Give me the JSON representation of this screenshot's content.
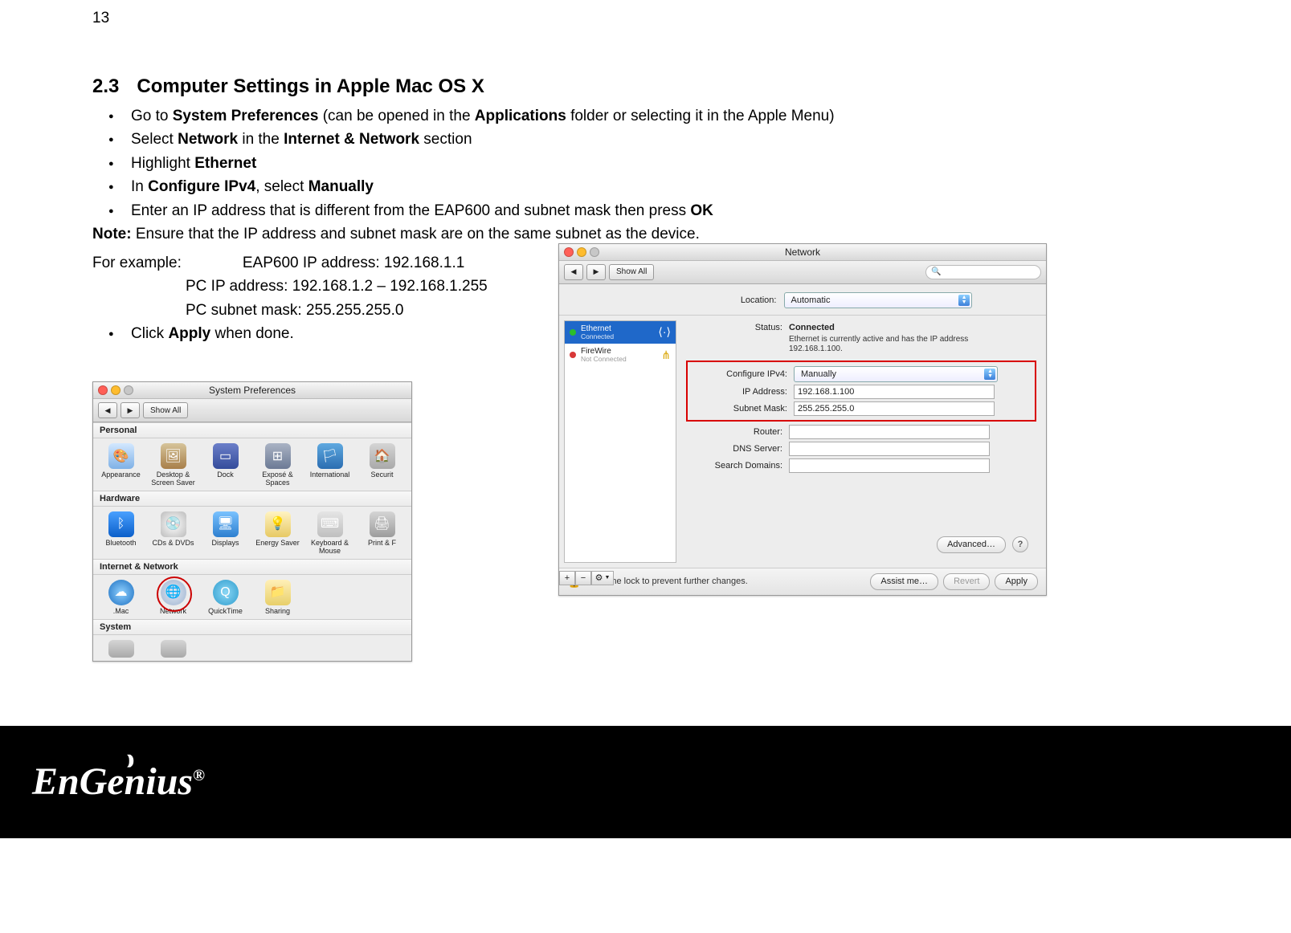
{
  "page_number": "13",
  "heading": {
    "num": "2.3",
    "title": "Computer Settings in Apple Mac OS X"
  },
  "bullets": [
    {
      "pre": "Go to ",
      "b1": "System Preferences",
      "mid": " (can be opened in the ",
      "b2": "Applications",
      "post": " folder or selecting it in the Apple Menu)"
    },
    {
      "pre": "Select ",
      "b1": "Network",
      "mid": " in the ",
      "b2": "Internet & Network",
      "post": " section"
    },
    {
      "pre": "Highlight ",
      "b1": "Ethernet",
      "mid": "",
      "b2": "",
      "post": ""
    },
    {
      "pre": "In ",
      "b1": "Configure IPv4",
      "mid": ", select ",
      "b2": "Manually",
      "post": ""
    },
    {
      "pre": "Enter an IP address that is different from the EAP600 and subnet mask then press ",
      "b1": "OK",
      "mid": "",
      "b2": "",
      "post": ""
    }
  ],
  "note_label": "Note:",
  "note_text": " Ensure that the IP address and subnet mask are on the same subnet as the device.",
  "example": {
    "line1_pre": "For example:",
    "line1_val": "EAP600 IP address: 192.168.1.1",
    "line2": "PC IP address: 192.168.1.2 – 192.168.1.255",
    "line3": "PC subnet mask: 255.255.255.0"
  },
  "last_bullet": {
    "pre": "Click ",
    "b1": "Apply",
    "post": " when done."
  },
  "sysprefs": {
    "title": "System Preferences",
    "show_all": "Show All",
    "sections": {
      "personal": "Personal",
      "hardware": "Hardware",
      "internet": "Internet & Network",
      "system": "System"
    },
    "personal_items": [
      "Appearance",
      "Desktop & Screen Saver",
      "Dock",
      "Exposé & Spaces",
      "International",
      "Securit"
    ],
    "hardware_items": [
      "Bluetooth",
      "CDs & DVDs",
      "Displays",
      "Energy Saver",
      "Keyboard & Mouse",
      "Print & F"
    ],
    "internet_items": [
      ".Mac",
      "Network",
      "QuickTime",
      "Sharing"
    ]
  },
  "network": {
    "title": "Network",
    "show_all": "Show All",
    "search_placeholder": "",
    "location_label": "Location:",
    "location_value": "Automatic",
    "sidebar": [
      {
        "name": "Ethernet",
        "sub": "Connected",
        "dot": "grn",
        "selected": true,
        "icon": "⇄"
      },
      {
        "name": "FireWire",
        "sub": "Not Connected",
        "dot": "red",
        "selected": false,
        "icon": "⋔"
      }
    ],
    "status_label": "Status:",
    "status_value": "Connected",
    "status_sub": "Ethernet is currently active and has the IP address 192.168.1.100.",
    "fields": {
      "configure_label": "Configure IPv4:",
      "configure_value": "Manually",
      "ip_label": "IP Address:",
      "ip_value": "192.168.1.100",
      "mask_label": "Subnet Mask:",
      "mask_value": "255.255.255.0",
      "router_label": "Router:",
      "router_value": "",
      "dns_label": "DNS Server:",
      "dns_value": "",
      "search_label": "Search Domains:",
      "search_value": ""
    },
    "advanced": "Advanced…",
    "help": "?",
    "lock_msg": "Click the lock to prevent further changes.",
    "assist": "Assist me…",
    "revert": "Revert",
    "apply": "Apply",
    "plus": "+",
    "minus": "−",
    "gear": "⚙"
  },
  "brand": "EnGenius",
  "brand_reg": "®"
}
